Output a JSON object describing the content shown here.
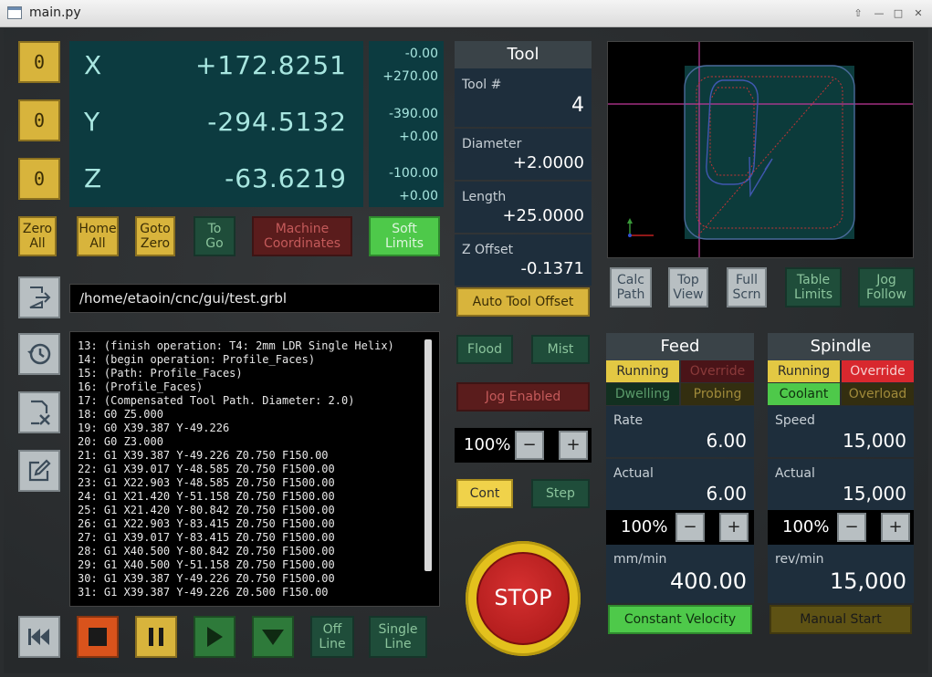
{
  "window": {
    "title": "main.py"
  },
  "dro": {
    "zero_label": "0",
    "axes": [
      {
        "name": "X",
        "value": "+172.8251",
        "min": "-0.00",
        "max": "+270.00"
      },
      {
        "name": "Y",
        "value": "-294.5132",
        "min": "-390.00",
        "max": "+0.00"
      },
      {
        "name": "Z",
        "value": "-63.6219",
        "min": "-100.00",
        "max": "+0.00"
      }
    ]
  },
  "controls": {
    "zero_all": "Zero\nAll",
    "home_all": "Home\nAll",
    "goto_zero": "Goto\nZero",
    "to_go": "To\nGo",
    "machine_coords": "Machine\nCoordinates",
    "soft_limits": "Soft\nLimits"
  },
  "file": {
    "path": "/home/etaoin/cnc/gui/test.grbl"
  },
  "gcode_lines": [
    "13: (finish operation: T4: 2mm LDR Single Helix)",
    "14: (begin operation: Profile_Faces)",
    "15: (Path: Profile_Faces)",
    "16: (Profile_Faces)",
    "17: (Compensated Tool Path. Diameter: 2.0)",
    "18: G0 Z5.000",
    "19: G0 X39.387 Y-49.226",
    "20: G0 Z3.000",
    "21: G1 X39.387 Y-49.226 Z0.750 F150.00",
    "22: G1 X39.017 Y-48.585 Z0.750 F1500.00",
    "23: G1 X22.903 Y-48.585 Z0.750 F1500.00",
    "24: G1 X21.420 Y-51.158 Z0.750 F1500.00",
    "25: G1 X21.420 Y-80.842 Z0.750 F1500.00",
    "26: G1 X22.903 Y-83.415 Z0.750 F1500.00",
    "27: G1 X39.017 Y-83.415 Z0.750 F1500.00",
    "28: G1 X40.500 Y-80.842 Z0.750 F1500.00",
    "29: G1 X40.500 Y-51.158 Z0.750 F1500.00",
    "30: G1 X39.387 Y-49.226 Z0.750 F1500.00",
    "31: G1 X39.387 Y-49.226 Z0.500 F150.00"
  ],
  "playback": {
    "off_line": "Off\nLine",
    "single_line": "Single\nLine"
  },
  "tool": {
    "header": "Tool",
    "tool_num_label": "Tool #",
    "tool_num": "4",
    "diameter_label": "Diameter",
    "diameter": "+2.0000",
    "length_label": "Length",
    "length": "+25.0000",
    "zoffset_label": "Z Offset",
    "zoffset": "-0.1371",
    "auto_offset": "Auto Tool Offset"
  },
  "jog": {
    "flood": "Flood",
    "mist": "Mist",
    "jog_enabled": "Jog Enabled",
    "percent": "100%",
    "minus": "−",
    "plus": "+",
    "cont": "Cont",
    "step": "Step",
    "stop": "STOP"
  },
  "view_buttons": {
    "calc_path": "Calc\nPath",
    "top_view": "Top\nView",
    "full_scrn": "Full\nScrn",
    "table_limits": "Table\nLimits",
    "jog_follow": "Jog\nFollow"
  },
  "feed": {
    "header": "Feed",
    "running": "Running",
    "override": "Override",
    "dwelling": "Dwelling",
    "probing": "Probing",
    "rate_label": "Rate",
    "rate": "6.00",
    "actual_label": "Actual",
    "actual": "6.00",
    "percent": "100%",
    "minus": "−",
    "plus": "+",
    "unit_label": "mm/min",
    "unit_value": "400.00",
    "mode": "Constant Velocity"
  },
  "spindle": {
    "header": "Spindle",
    "running": "Running",
    "override": "Override",
    "coolant": "Coolant",
    "overload": "Overload",
    "speed_label": "Speed",
    "speed": "15,000",
    "actual_label": "Actual",
    "actual": "15,000",
    "percent": "100%",
    "minus": "−",
    "plus": "+",
    "unit_label": "rev/min",
    "unit_value": "15,000",
    "mode": "Manual Start"
  },
  "colors": {
    "accent_yellow": "#d8b43c",
    "dro_bg": "#0c3b40",
    "stop_red": "#c41e1e",
    "active_green": "#4ec94a",
    "override_red": "#d8282e"
  }
}
